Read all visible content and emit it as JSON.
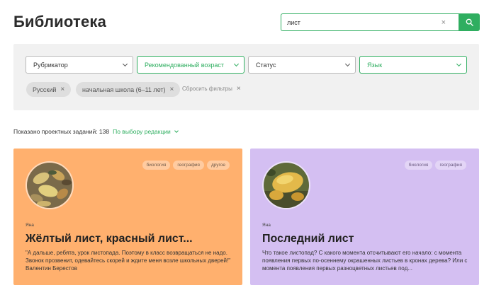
{
  "header": {
    "title": "Библиотека",
    "search": {
      "value": "лист",
      "clear_icon": "×"
    }
  },
  "filters": {
    "selects": [
      {
        "label": "Рубрикатор",
        "active": false
      },
      {
        "label": "Рекомендованный возраст",
        "active": true
      },
      {
        "label": "Статус",
        "active": false
      },
      {
        "label": "Язык",
        "active": true
      }
    ],
    "chips": [
      {
        "label": "Русский"
      },
      {
        "label": "начальная школа (6–11 лет)"
      }
    ],
    "chip_remove": "×",
    "reset_label": "Сбросить фильтры"
  },
  "results": {
    "count_text": "Показано проектных заданий: 138",
    "sort_label": "По выбору редакции"
  },
  "cards": [
    {
      "tags": [
        "биология",
        "география",
        "другое"
      ],
      "author": "Яна",
      "title": "Жёлтый лист, красный лист...",
      "description": "\"А дальше, ребята, урок листопада. Поэтому в класс возвращаться не надо. Звонок прозвенит, одевайтесь скорей и ждите меня возле школьных дверей!\" Валентин Берестов",
      "color": "#ffb06e"
    },
    {
      "tags": [
        "биология",
        "география"
      ],
      "author": "Яна",
      "title": "Последний лист",
      "description": "Что такое листопад? С какого момента отсчитывают его начало: с момента появления первых по-осеннему окрашенных листьев в кронах дерева? Или с момента появления первых разноцветных листьев под...",
      "color": "#d4bff2"
    }
  ],
  "colors": {
    "accent": "#2fae60",
    "panel": "#f1f1f1"
  }
}
